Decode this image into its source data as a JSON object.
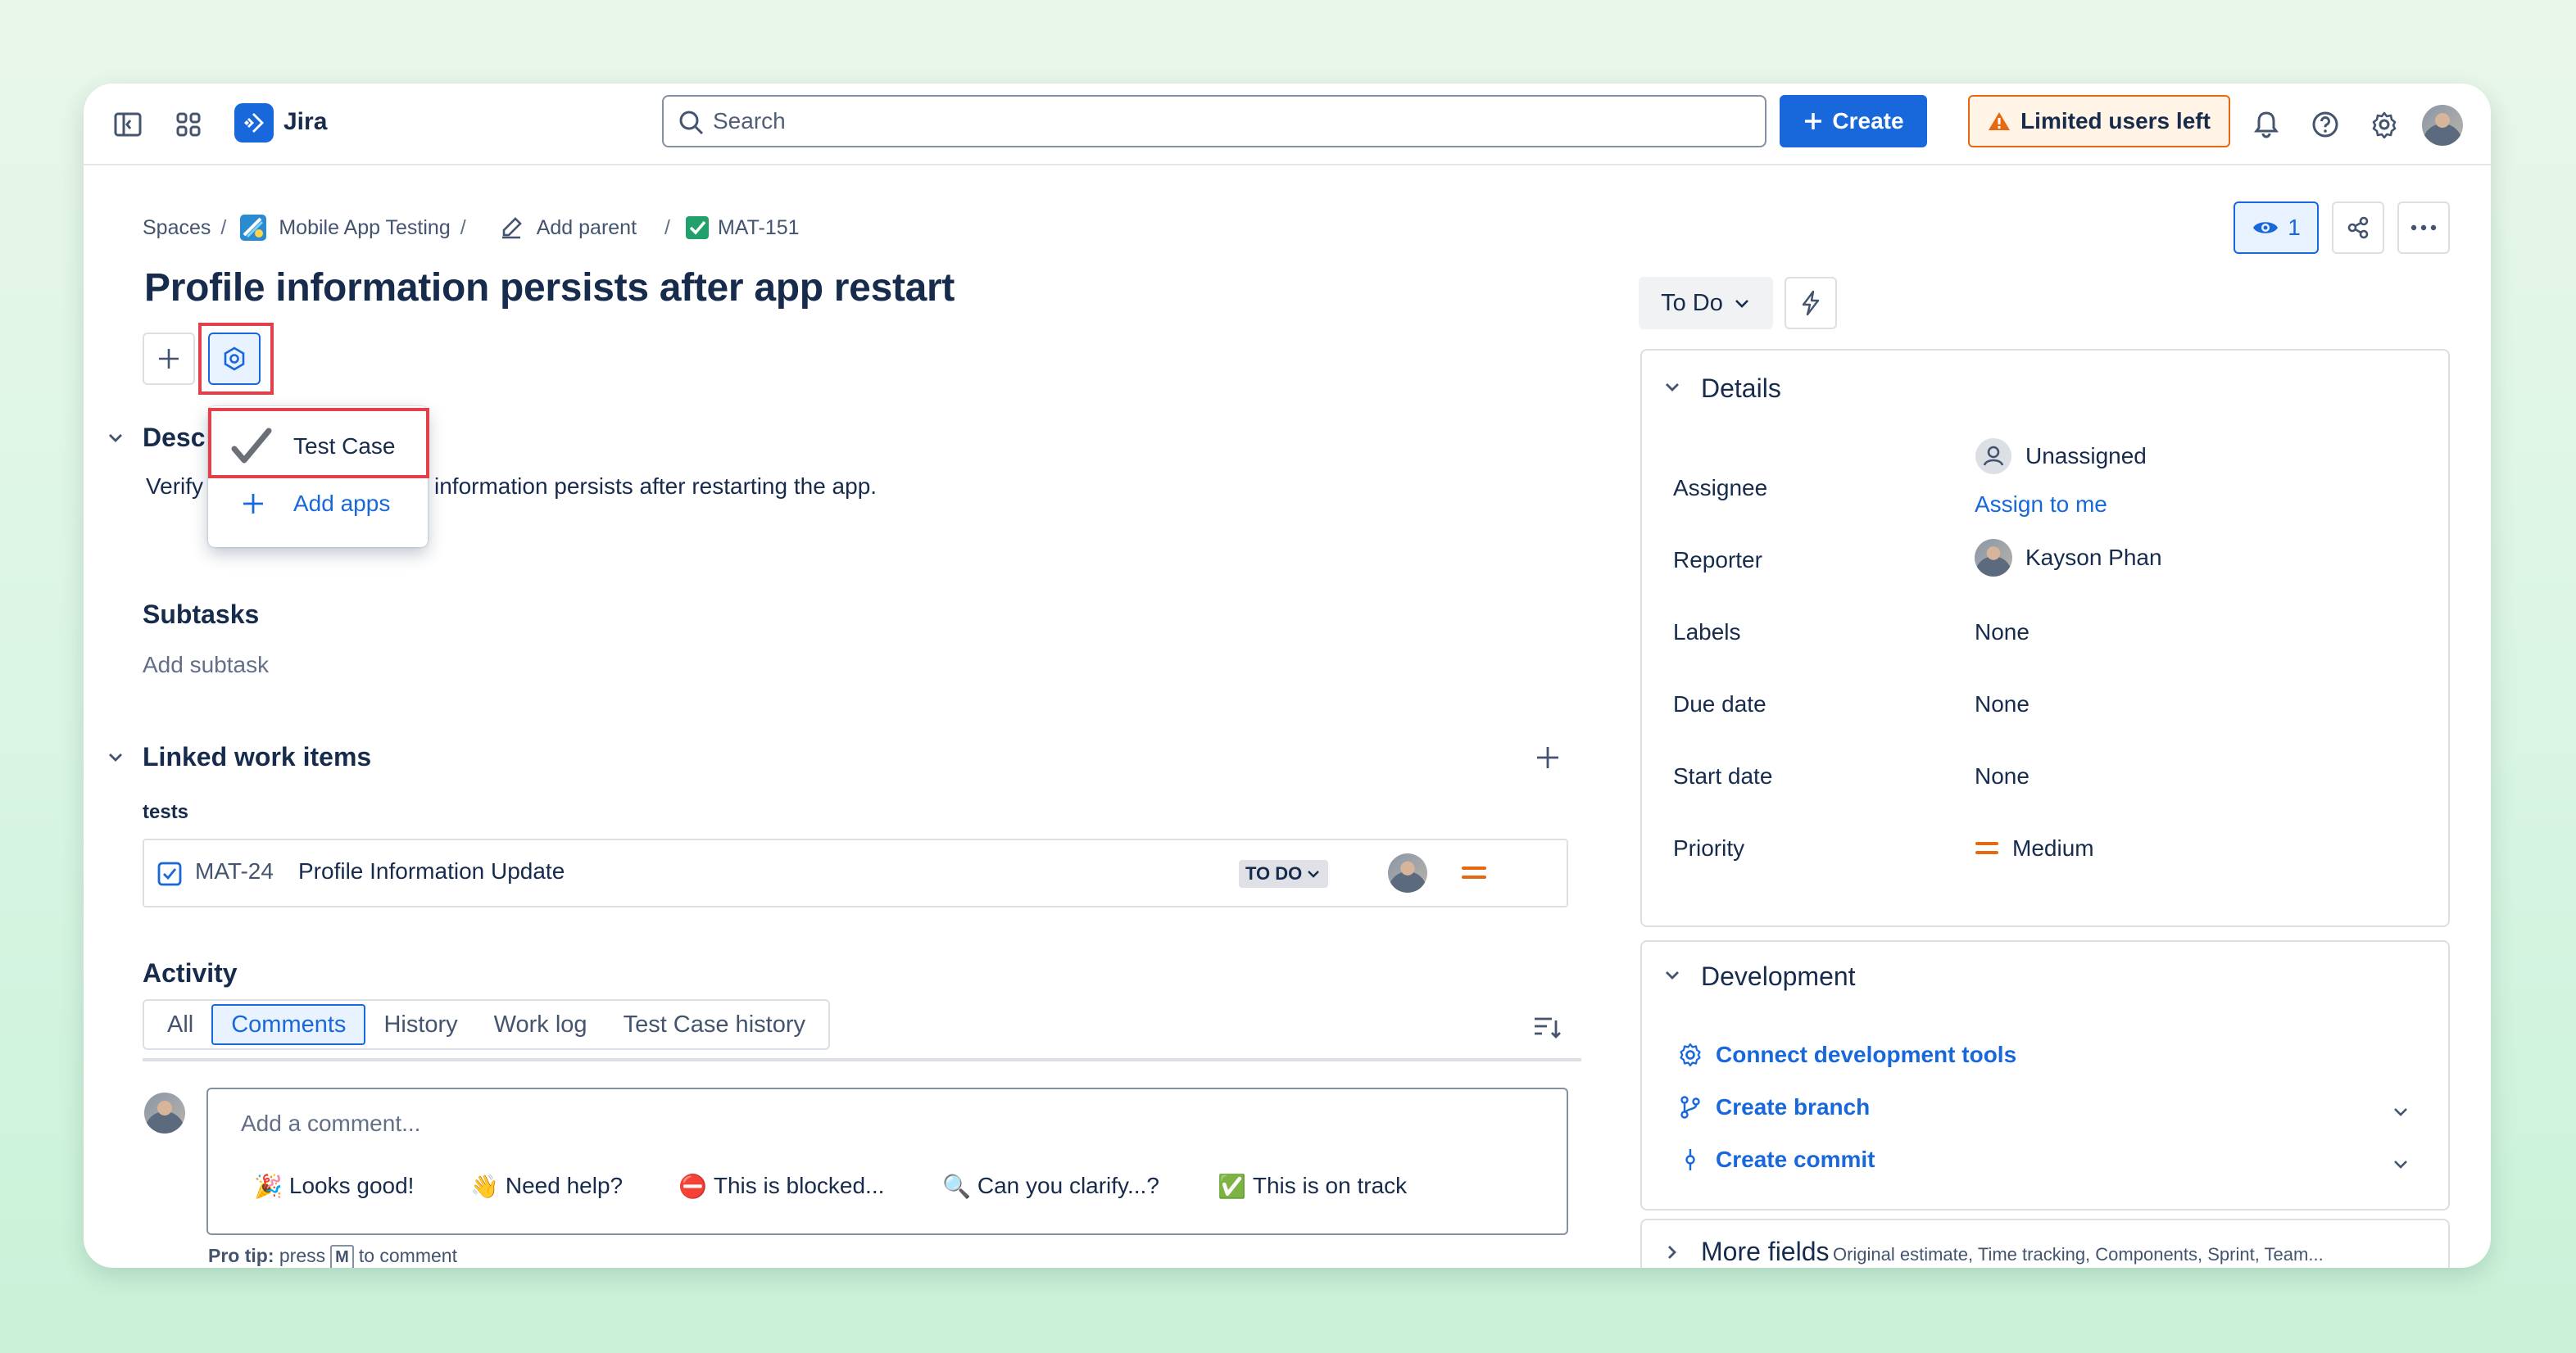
{
  "app": {
    "name": "Jira"
  },
  "topbar": {
    "search_placeholder": "Search",
    "create_label": "Create",
    "limited_label": "Limited users left",
    "icons": [
      "sidebar-toggle-icon",
      "app-switcher-icon",
      "bell-icon",
      "help-icon",
      "gear-icon"
    ]
  },
  "breadcrumb": {
    "spaces": "Spaces",
    "project": "Mobile App Testing",
    "add_parent": "Add parent",
    "issue_key": "MAT-151",
    "sep": "/"
  },
  "issue": {
    "title": "Profile information persists after app restart",
    "watchers": "1"
  },
  "apps_popup": {
    "items": [
      {
        "label": "Test Case"
      },
      {
        "label": "Add apps"
      }
    ]
  },
  "description": {
    "heading_partial": "Desc",
    "text_start": "Verify",
    "text_end": "information persists after restarting the app."
  },
  "subtasks": {
    "heading": "Subtasks",
    "add_label": "Add subtask"
  },
  "linked": {
    "heading": "Linked work items",
    "relation": "tests",
    "items": [
      {
        "key": "MAT-24",
        "summary": "Profile Information Update",
        "status": "TO DO"
      }
    ]
  },
  "activity": {
    "heading": "Activity",
    "tabs": [
      "All",
      "Comments",
      "History",
      "Work log",
      "Test Case history"
    ],
    "selected_tab": "Comments",
    "comment_placeholder": "Add a comment...",
    "quick_replies": [
      {
        "emoji": "🎉",
        "label": "Looks good!"
      },
      {
        "emoji": "👋",
        "label": "Need help?"
      },
      {
        "emoji": "⛔",
        "label": "This is blocked..."
      },
      {
        "emoji": "🔍",
        "label": "Can you clarify...?"
      },
      {
        "emoji": "✅",
        "label": "This is on track"
      }
    ],
    "pro_tip_bold": "Pro tip:",
    "pro_tip_pre": "press",
    "pro_tip_key": "M",
    "pro_tip_post": "to comment"
  },
  "status": {
    "label": "To Do"
  },
  "details": {
    "heading": "Details",
    "fields": {
      "assignee_label": "Assignee",
      "assignee_value": "Unassigned",
      "assign_to_me": "Assign to me",
      "reporter_label": "Reporter",
      "reporter_value": "Kayson Phan",
      "labels_label": "Labels",
      "labels_value": "None",
      "due_label": "Due date",
      "due_value": "None",
      "start_label": "Start date",
      "start_value": "None",
      "priority_label": "Priority",
      "priority_value": "Medium"
    }
  },
  "development": {
    "heading": "Development",
    "items": [
      "Connect development tools",
      "Create branch",
      "Create commit"
    ]
  },
  "more_fields": {
    "heading": "More fields",
    "summary": "Original estimate, Time tracking, Components, Sprint, Team..."
  },
  "colors": {
    "brand": "#1868db",
    "warning": "#e56910",
    "highlight": "#e2404a",
    "priority_medium": "#e56910"
  }
}
